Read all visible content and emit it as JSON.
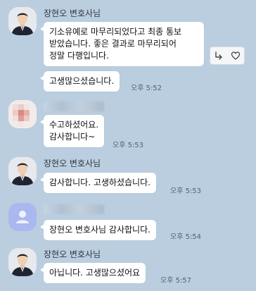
{
  "messages": [
    {
      "sender": "장현오 변호사님",
      "text": "기소유예로 마무리되었다고 최종 통보 받았습니다. 좋은 결과로 마무리되어 정말 다행입니다.",
      "time": ""
    },
    {
      "sender": "",
      "text": "고생많으셨습니다.",
      "time": "오후 5:52"
    },
    {
      "sender": "",
      "text": "수고하셨어요. 감사합니다~",
      "time": "오후 5:53"
    },
    {
      "sender": "장현오 변호사님",
      "text": "감사합니다. 고생하셨습니다.",
      "time": "오후 5:53"
    },
    {
      "sender": "",
      "text": "장현오 변호사님 감사합니다.",
      "time": "오후 5:54"
    },
    {
      "sender": "장현오 변호사님",
      "text": "아닙니다. 고생많으셨어요",
      "time": "오후 5:57"
    }
  ],
  "icons": {
    "reply": "reply-arrow-icon",
    "like": "heart-outline-icon",
    "default_avatar": "person-icon"
  },
  "colors": {
    "background": "#bacee0",
    "bubble": "#ffffff",
    "default_avatar": "#aab8f0"
  }
}
